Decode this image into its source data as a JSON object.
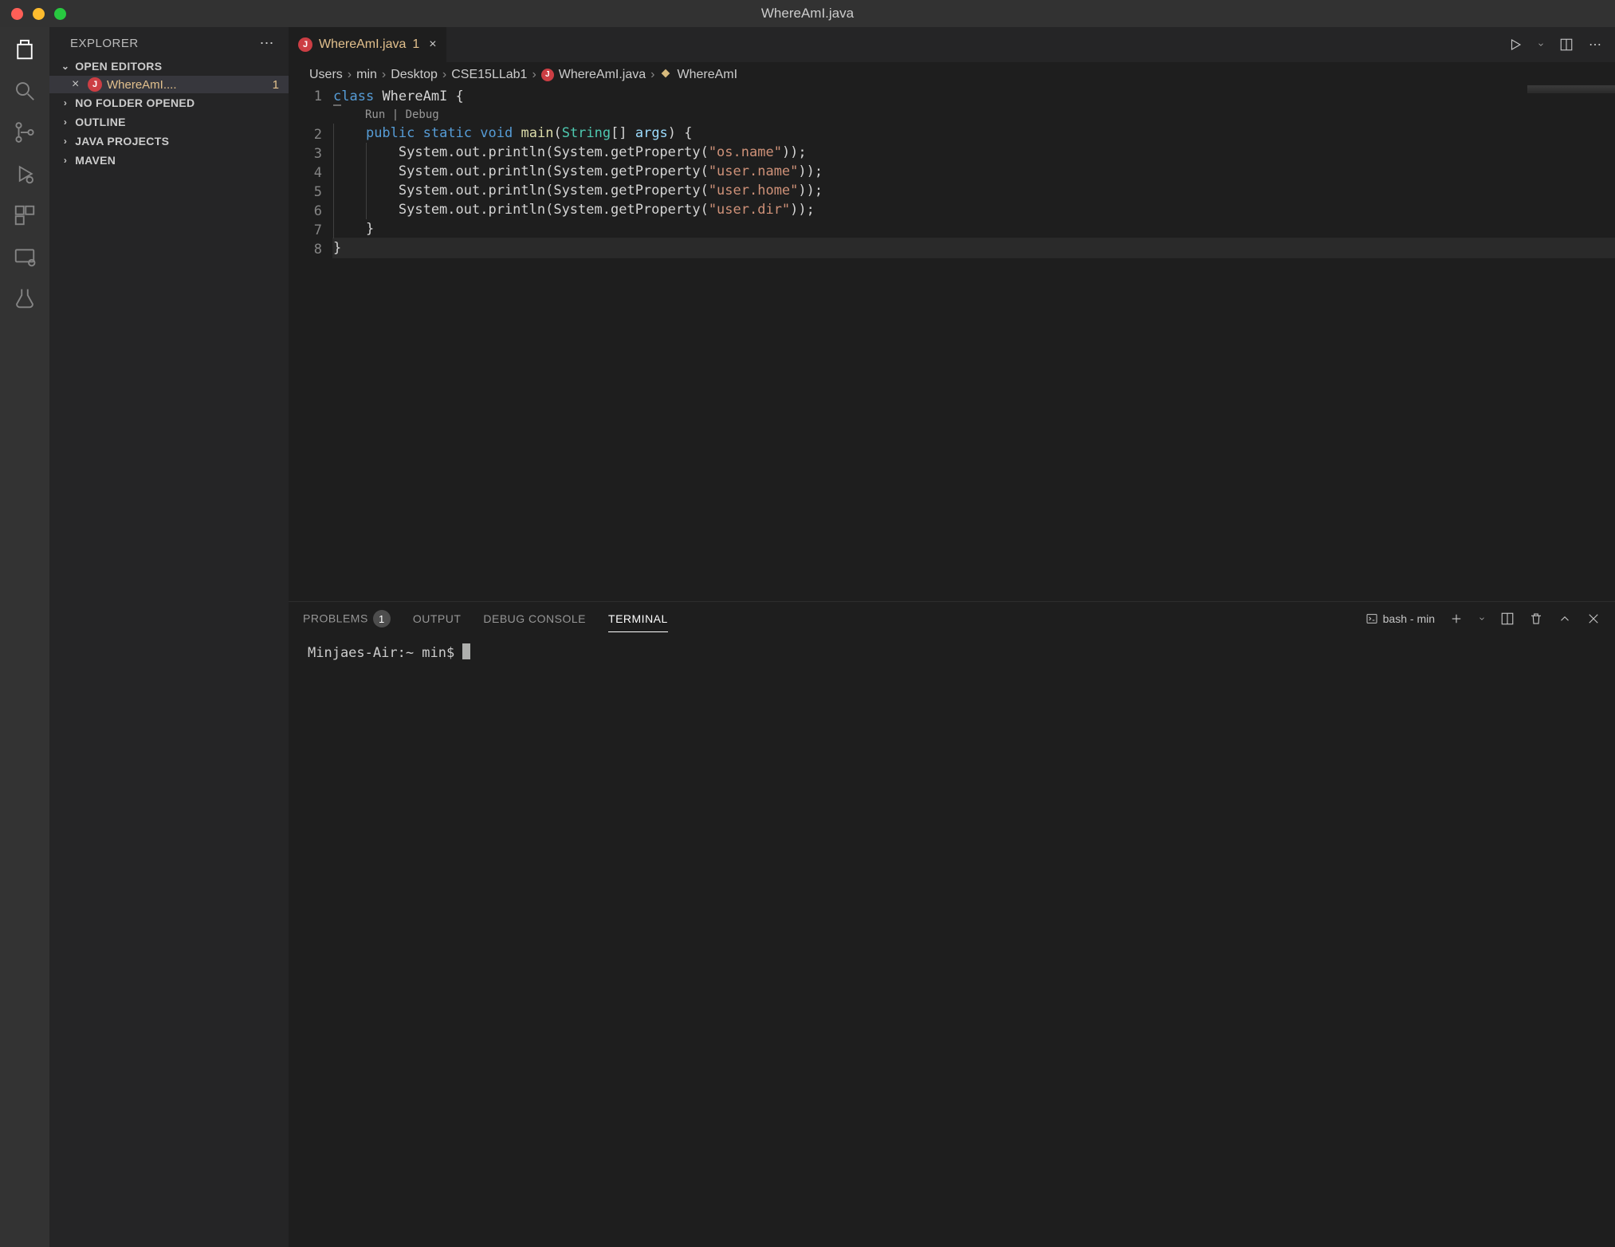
{
  "window": {
    "title": "WhereAmI.java"
  },
  "sidebar": {
    "title": "EXPLORER",
    "sections": {
      "open_editors": "OPEN EDITORS",
      "no_folder": "NO FOLDER OPENED",
      "outline": "OUTLINE",
      "java_projects": "JAVA PROJECTS",
      "maven": "MAVEN"
    },
    "open_file": {
      "name": "WhereAmI....",
      "count": "1",
      "badge": "J"
    }
  },
  "tab": {
    "name": "WhereAmI.java",
    "count": "1",
    "badge": "J"
  },
  "breadcrumb": {
    "parts": [
      "Users",
      "min",
      "Desktop",
      "CSE15LLab1",
      "WhereAmI.java",
      "WhereAmI"
    ],
    "badge": "J"
  },
  "code": {
    "codelens": "Run | Debug",
    "lines": [
      {
        "n": "1",
        "html": "<span class='kw'>class</span> WhereAmI {",
        "typing": "c"
      },
      {
        "n": "2",
        "html": "    <span class='kw'>public</span> <span class='kw'>static</span> <span class='kw'>void</span> <span class='mtd'>main</span>(<span class='type'>String</span>[] <span class='var'>args</span>) {"
      },
      {
        "n": "3",
        "html": "        System.out.println(System.getProperty(<span class='str'>\"os.name\"</span>));"
      },
      {
        "n": "4",
        "html": "        System.out.println(System.getProperty(<span class='str'>\"user.name\"</span>));"
      },
      {
        "n": "5",
        "html": "        System.out.println(System.getProperty(<span class='str'>\"user.home\"</span>));"
      },
      {
        "n": "6",
        "html": "        System.out.println(System.getProperty(<span class='str'>\"user.dir\"</span>));"
      },
      {
        "n": "7",
        "html": "    }"
      },
      {
        "n": "8",
        "html": "}"
      }
    ]
  },
  "panel": {
    "tabs": {
      "problems": "PROBLEMS",
      "problems_count": "1",
      "output": "OUTPUT",
      "debug": "DEBUG CONSOLE",
      "terminal": "TERMINAL"
    },
    "terminal_label": "bash - min",
    "prompt": "Minjaes-Air:~ min$ "
  }
}
